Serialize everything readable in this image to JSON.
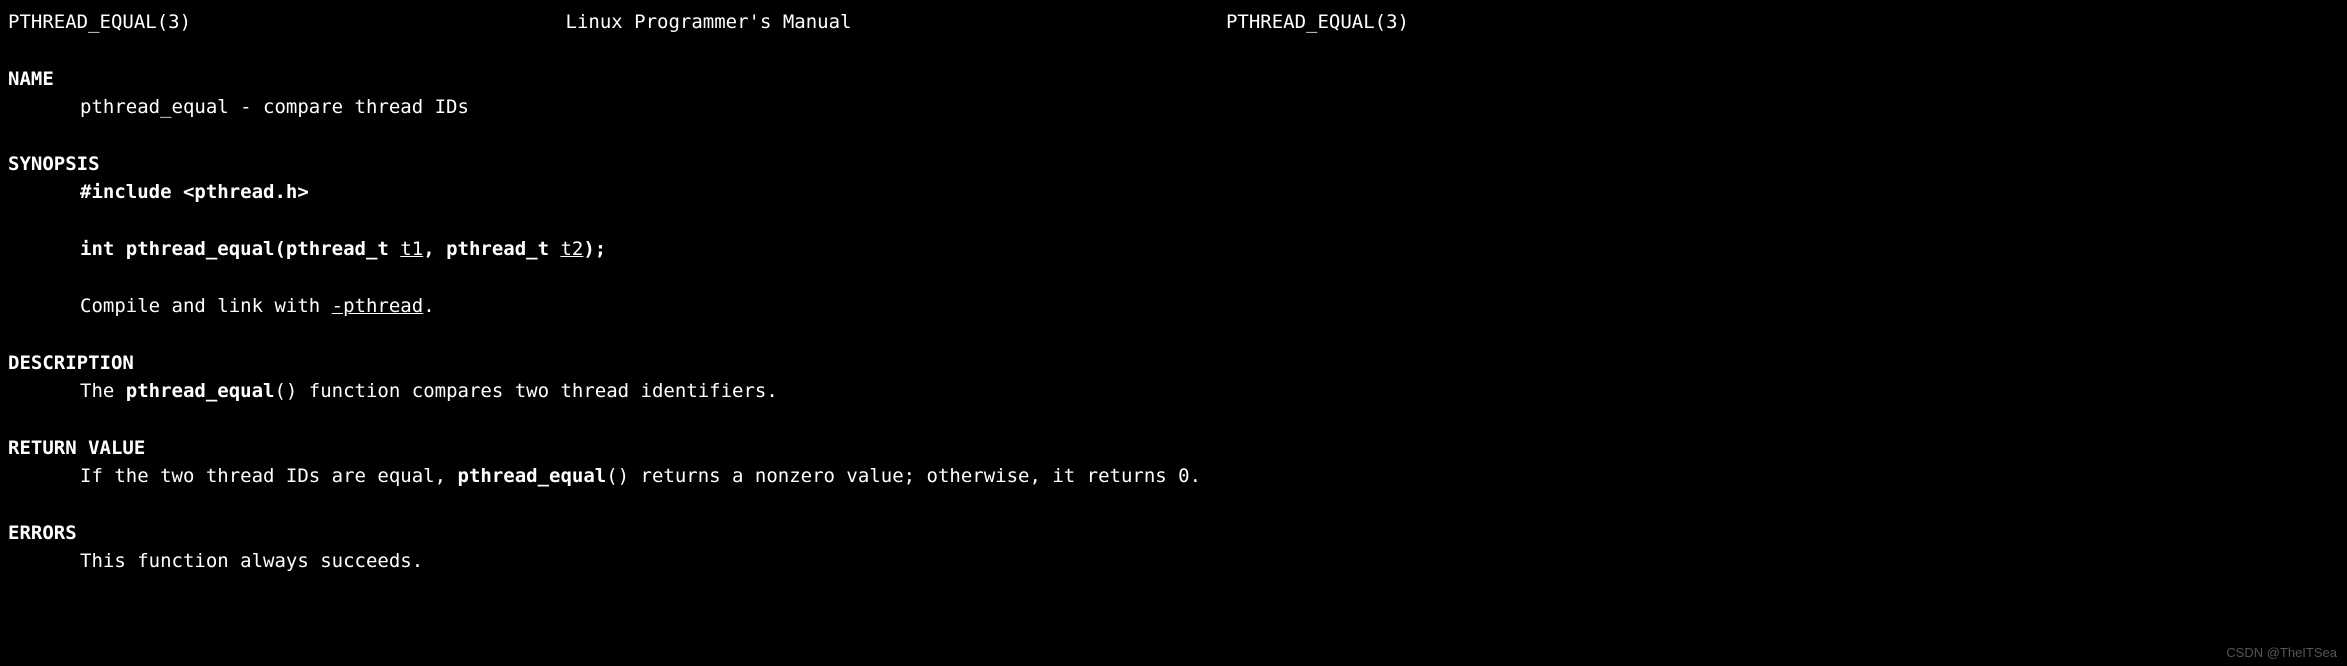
{
  "header": {
    "left": "PTHREAD_EQUAL(3)",
    "center": "Linux Programmer's Manual",
    "right": "PTHREAD_EQUAL(3)"
  },
  "sections": {
    "name": {
      "heading": "NAME",
      "text": "pthread_equal - compare thread IDs"
    },
    "synopsis": {
      "heading": "SYNOPSIS",
      "include": "#include <pthread.h>",
      "signature_prefix": "int pthread_equal(pthread_t ",
      "signature_t1": "t1",
      "signature_mid": ", pthread_t ",
      "signature_t2": "t2",
      "signature_suffix": ");",
      "compile_prefix": "Compile and link with ",
      "compile_flag": "-pthread",
      "compile_suffix": "."
    },
    "description": {
      "heading": "DESCRIPTION",
      "text_prefix": "The ",
      "text_func": "pthread_equal",
      "text_suffix": "() function compares two thread identifiers."
    },
    "return_value": {
      "heading": "RETURN VALUE",
      "text_prefix": "If the two thread IDs are equal, ",
      "text_func": "pthread_equal",
      "text_suffix": "() returns a nonzero value; otherwise, it returns 0."
    },
    "errors": {
      "heading": "ERRORS",
      "text": "This function always succeeds."
    }
  },
  "watermark": "CSDN @TheITSea"
}
